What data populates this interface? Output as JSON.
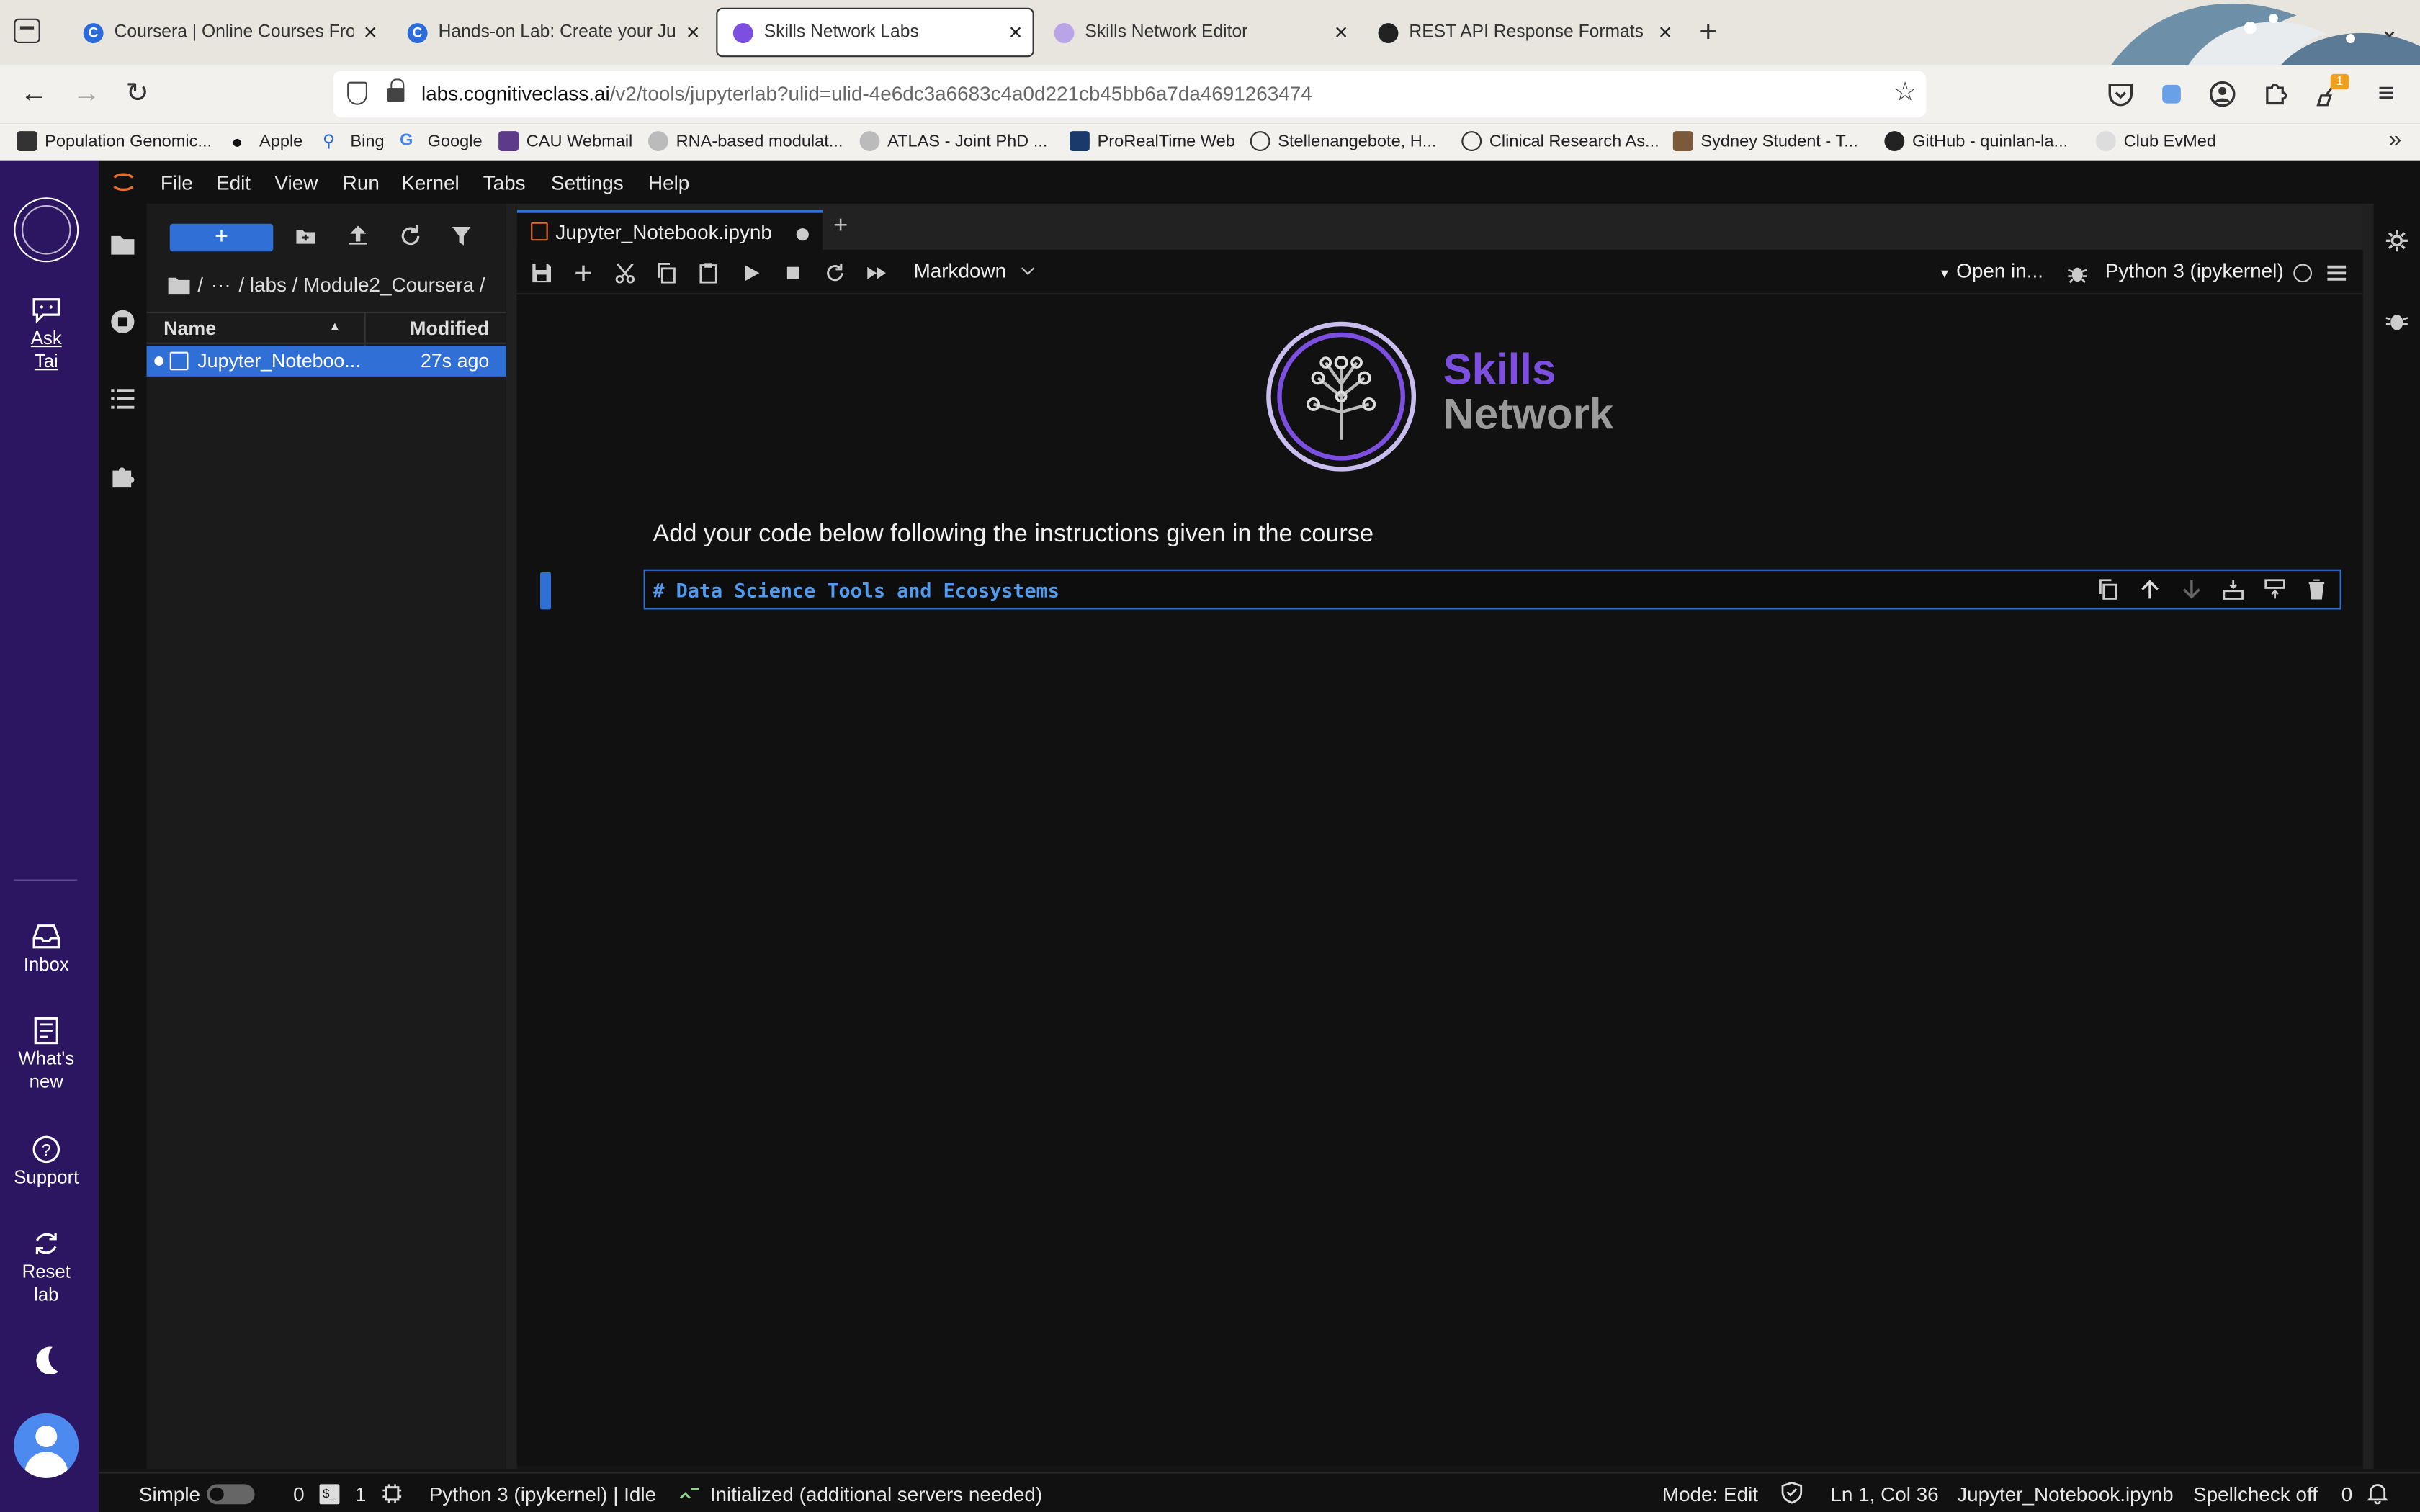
{
  "browser": {
    "tabs": [
      {
        "title": "Coursera | Online Courses From",
        "favicon": "coursera-icon",
        "color": "#2b6bd9"
      },
      {
        "title": "Hands-on Lab: Create your Jup",
        "favicon": "coursera-icon",
        "color": "#2b6bd9"
      },
      {
        "title": "Skills Network Labs",
        "favicon": "skills-network-icon",
        "color": "#7c4fe0"
      },
      {
        "title": "Skills Network Editor",
        "favicon": "skills-network-icon",
        "color": "#b9a4e8"
      },
      {
        "title": "REST API Response Formats",
        "favicon": "openai-icon",
        "color": "#222222"
      }
    ],
    "url_host": "labs.cognitiveclass.ai",
    "url_path": "/v2/tools/jupyterlab?ulid=ulid-4e6dc3a6683c4a0d221cb45bb6a7da4691263474",
    "extension_badge": "1",
    "bookmarks": [
      "Population Genomic...",
      "Apple",
      "Bing",
      "Google",
      "CAU Webmail",
      "RNA-based modulat...",
      "ATLAS - Joint PhD ...",
      "ProRealTime Web",
      "Stellenangebote, H...",
      "Clinical Research As...",
      "Sydney Student - T...",
      "GitHub - quinlan-la...",
      "Club EvMed"
    ]
  },
  "rail": {
    "ask_label_1": "Ask",
    "ask_label_2": "Tai",
    "inbox": "Inbox",
    "whats_new_1": "What's",
    "whats_new_2": "new",
    "support": "Support",
    "reset_1": "Reset",
    "reset_2": "lab"
  },
  "menu": [
    "File",
    "Edit",
    "View",
    "Run",
    "Kernel",
    "Tabs",
    "Settings",
    "Help"
  ],
  "filebrowser": {
    "new_label": "+",
    "breadcrumb": [
      "/",
      "···",
      "/ labs / Module2_Coursera /"
    ],
    "col_name": "Name",
    "col_modified": "Modified",
    "files": [
      {
        "name": "Jupyter_Noteboo...",
        "modified": "27s ago"
      }
    ]
  },
  "notebook": {
    "tab_title": "Jupyter_Notebook.ipynb",
    "cell_type": "Markdown",
    "open_in": "Open in...",
    "kernel": "Python 3 (ipykernel)",
    "logo_skills": "Skills",
    "logo_network": "Network",
    "markdown_text": "Add your code below following the instructions given in the course",
    "cell_source": "# Data Science Tools and Ecosystems"
  },
  "statusbar": {
    "simple": "Simple",
    "terminals": "0",
    "kernels": "1",
    "kernel_status": "Python 3 (ipykernel) | Idle",
    "lsp": "Initialized (additional servers needed)",
    "mode": "Mode: Edit",
    "position": "Ln 1, Col 36",
    "file": "Jupyter_Notebook.ipynb",
    "spellcheck": "Spellcheck off",
    "notifications": "0"
  },
  "colors": {
    "accent": "#2f6fd6",
    "brand_purple": "#7c4fe0",
    "rail": "#2c1561"
  }
}
